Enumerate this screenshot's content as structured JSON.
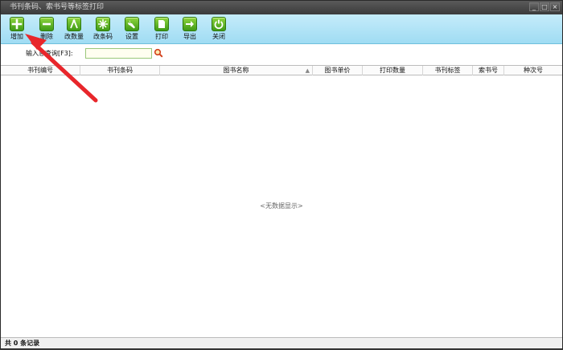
{
  "window": {
    "title": "书刊条码、索书号等标签打印",
    "min_label": "_",
    "max_label": "□",
    "close_label": "×"
  },
  "toolbar": {
    "items": [
      {
        "id": "add",
        "label": "增加",
        "icon": "plus-icon"
      },
      {
        "id": "delete",
        "label": "删除",
        "icon": "minus-icon"
      },
      {
        "id": "edit-qty",
        "label": "改数量",
        "icon": "compass-icon"
      },
      {
        "id": "edit-barcode",
        "label": "改条码",
        "icon": "spark-icon"
      },
      {
        "id": "settings",
        "label": "设置",
        "icon": "wrench-icon"
      },
      {
        "id": "print",
        "label": "打印",
        "icon": "printer-icon"
      },
      {
        "id": "export",
        "label": "导出",
        "icon": "export-arrow-icon"
      },
      {
        "id": "close",
        "label": "关闭",
        "icon": "power-icon"
      }
    ]
  },
  "search": {
    "label": "输入息查询[F3]:",
    "value": "",
    "placeholder": ""
  },
  "table": {
    "columns": [
      "书刊编号",
      "书刊条码",
      "图书名称",
      "图书单价",
      "打印数量",
      "书刊标签",
      "索书号",
      "种次号"
    ],
    "sort_indicator": "▲",
    "empty_text": "<无数据显示>"
  },
  "status": {
    "text": "共 0 条记录"
  },
  "colors": {
    "toolbar_bg": "#a9e0f5",
    "icon_green": "#4fa81c",
    "annotation_arrow": "#e8262b"
  }
}
